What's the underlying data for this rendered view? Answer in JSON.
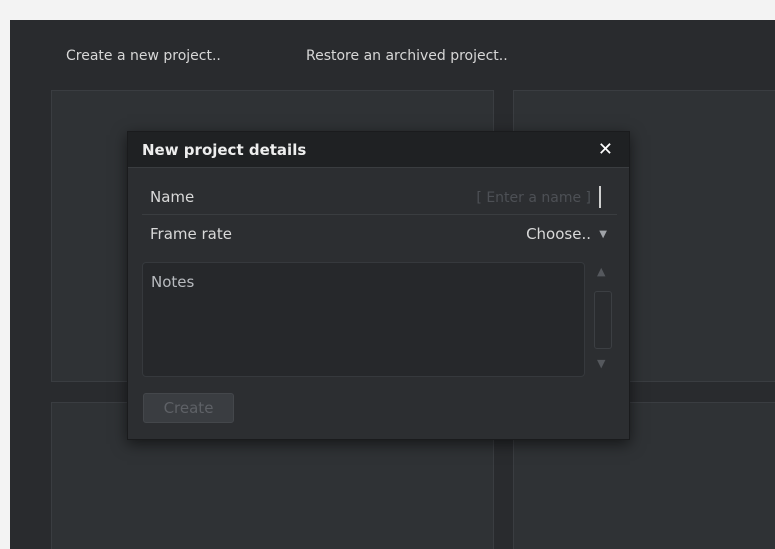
{
  "topbar": {
    "create_project": "Create a new project..",
    "restore_project": "Restore an archived project.."
  },
  "dialog": {
    "title": "New project details",
    "close_glyph": "✕",
    "name_label": "Name",
    "name_placeholder": "[ Enter a name ]",
    "name_value": "",
    "frame_rate_label": "Frame rate",
    "frame_rate_value": "Choose..",
    "notes_placeholder": "Notes",
    "create_label": "Create"
  },
  "icons": {
    "close": "close-icon",
    "dropdown": "chevron-down-icon",
    "scroll_up": "scroll-up-icon",
    "scroll_down": "scroll-down-icon"
  },
  "colors": {
    "background": "#292b2e",
    "dialog_header": "#1f2123",
    "text": "#d9d9d9",
    "disabled_button": "#3a3d41"
  }
}
